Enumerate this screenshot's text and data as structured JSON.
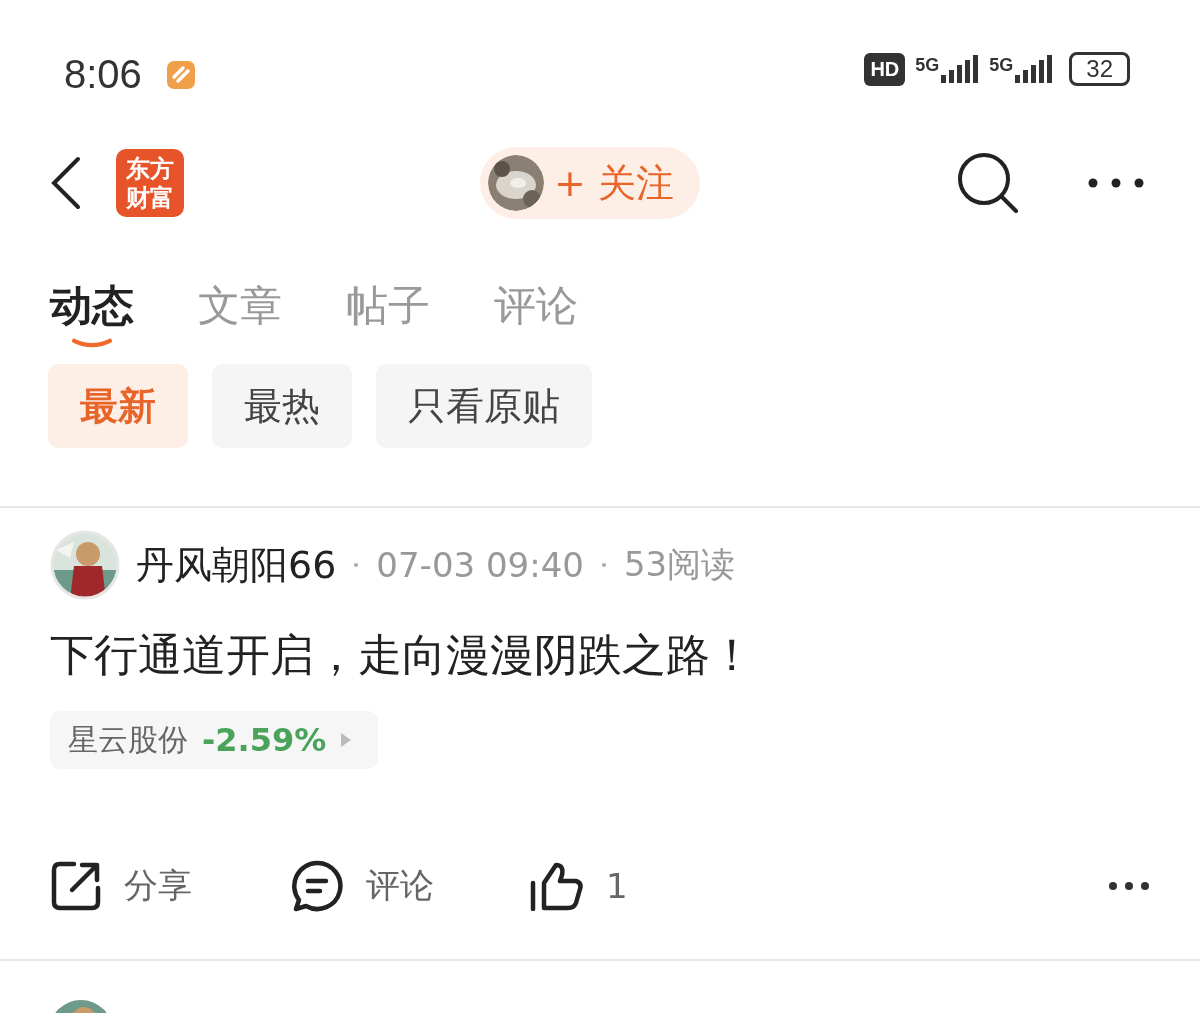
{
  "status_bar": {
    "time": "8:06",
    "hd_label": "HD",
    "sim_1": "5G",
    "sim_2": "5G",
    "battery": "32"
  },
  "header": {
    "logo": [
      "东方",
      "财富"
    ],
    "follow_button": "+ 关注"
  },
  "tabs": [
    {
      "label": "动态",
      "selected": true
    },
    {
      "label": "文章",
      "selected": false
    },
    {
      "label": "帖子",
      "selected": false
    },
    {
      "label": "评论",
      "selected": false
    }
  ],
  "filters": [
    {
      "label": "最新",
      "selected": true
    },
    {
      "label": "最热",
      "selected": false
    },
    {
      "label": "只看原贴",
      "selected": false
    }
  ],
  "posts": [
    {
      "author": "丹风朝阳66",
      "time": "07-03 09:40",
      "reads": "53阅读",
      "title": "下行通道开启，走向漫漫阴跌之路！",
      "stock": {
        "name": "星云股份",
        "change": "-2.59%"
      },
      "actions": {
        "share": "分享",
        "comment": "评论",
        "likes": "1"
      }
    }
  ]
}
